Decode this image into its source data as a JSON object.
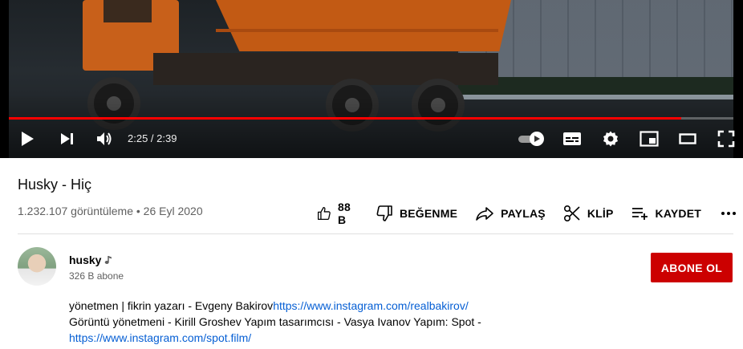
{
  "player": {
    "progress_fraction": 0.928,
    "time_display": "2:25 / 2:39",
    "controls": {
      "play": "play-icon",
      "next": "next-icon",
      "volume": "volume-icon",
      "autoplay": "autoplay-toggle-icon",
      "subtitles": "subtitles-icon",
      "settings": "gear-icon",
      "miniplayer": "miniplayer-icon",
      "theater": "theater-mode-icon",
      "fullscreen": "fullscreen-icon"
    },
    "colors": {
      "progress": "#ff0000"
    }
  },
  "video": {
    "title": "Husky - Hiç",
    "meta": "1.232.107 görüntüleme • 26 Eyl 2020"
  },
  "actions": {
    "like_count": "88 B",
    "dislike": "BEĞENME",
    "share": "PAYLAŞ",
    "clip": "KLİP",
    "save": "KAYDET",
    "more": "..."
  },
  "channel": {
    "name": "husky",
    "badge": "music-note-icon",
    "subscribers": "326 B abone",
    "subscribe_label": "ABONE OL",
    "colors": {
      "subscribe": "#cc0000"
    }
  },
  "description": {
    "line1_text": "yönetmen | fikrin yazarı - Evgeny Bakirov",
    "line1_link": "https://www.instagram.com/realbakirov/",
    "line2_text": "Görüntü yönetmeni - Kirill Groshev Yapım tasarımcısı - Vasya Ivanov Yapım: Spot -",
    "line3_link": "https://www.instagram.com/spot.film/"
  }
}
